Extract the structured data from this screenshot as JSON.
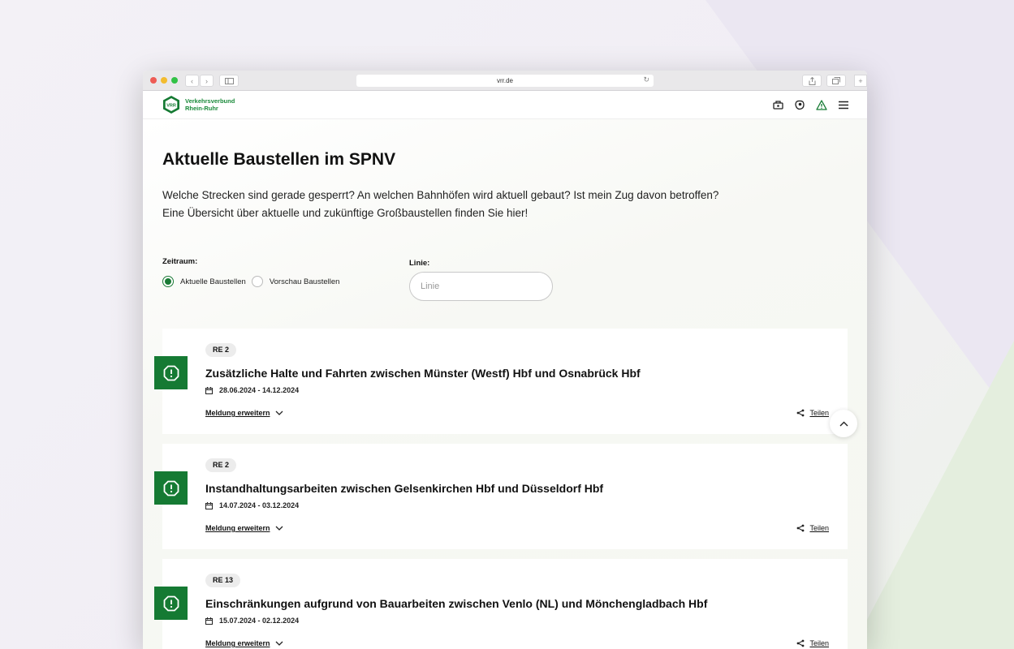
{
  "browser": {
    "url": "vrr.de"
  },
  "header": {
    "logo_abbr": "VRR",
    "logo_line1": "Verkehrsverbund",
    "logo_line2": "Rhein-Ruhr",
    "colors": {
      "brand": "#157a33"
    },
    "icons": [
      "ticket-icon",
      "accessibility-icon",
      "warning-icon",
      "menu-icon"
    ]
  },
  "page": {
    "title": "Aktuelle Baustellen im SPNV",
    "intro": "Welche Strecken sind gerade gesperrt? An welchen Bahnhöfen wird aktuell gebaut? Ist mein Zug davon betroffen? Eine Übersicht über aktuelle und zukünftige Großbaustellen finden Sie hier!"
  },
  "filters": {
    "zeitraum_label": "Zeitraum:",
    "options": [
      {
        "label": "Aktuelle Baustellen",
        "checked": true
      },
      {
        "label": "Vorschau Baustellen",
        "checked": false
      }
    ],
    "linie_label": "Linie:",
    "linie_placeholder": "Linie"
  },
  "cards": [
    {
      "line": "RE 2",
      "title": "Zusätzliche Halte und Fahrten zwischen Münster (Westf) Hbf und Osnabrück Hbf",
      "date": "28.06.2024 - 14.12.2024",
      "expand_label": "Meldung erweitern",
      "share_label": "Teilen"
    },
    {
      "line": "RE 2",
      "title": "Instandhaltungsarbeiten zwischen Gelsenkirchen Hbf und Düsseldorf Hbf",
      "date": "14.07.2024 - 03.12.2024",
      "expand_label": "Meldung erweitern",
      "share_label": "Teilen"
    },
    {
      "line": "RE 13",
      "title": "Einschränkungen aufgrund von Bauarbeiten zwischen Venlo (NL) und Mönchengladbach Hbf",
      "date": "15.07.2024 - 02.12.2024",
      "expand_label": "Meldung erweitern",
      "share_label": "Teilen"
    }
  ]
}
